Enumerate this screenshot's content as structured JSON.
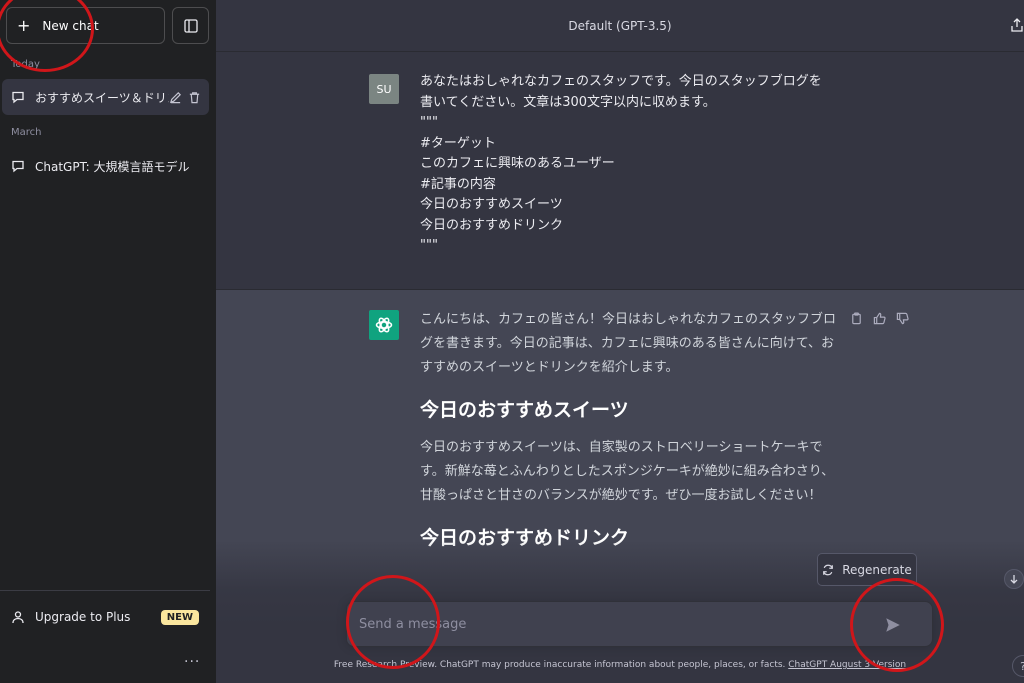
{
  "sidebar": {
    "new_chat_label": "New chat",
    "sections": [
      {
        "label": "Today"
      },
      {
        "label": "March"
      }
    ],
    "chats": [
      {
        "label": "おすすめスイーツ＆ドリンク"
      },
      {
        "label": "ChatGPT: 大規模言語モデル"
      }
    ],
    "upgrade_label": "Upgrade to Plus",
    "upgrade_badge": "NEW",
    "more_label": "..."
  },
  "header": {
    "model_title": "Default (GPT-3.5)"
  },
  "conversation": {
    "user": {
      "avatar_initials": "SU",
      "lines": [
        "あなたはおしゃれなカフェのスタッフです。今日のスタッフブログを",
        "書いてください。文章は300文字以内に収めます。",
        "\"\"\"",
        "#ターゲット",
        "このカフェに興味のあるユーザー",
        "#記事の内容",
        "今日のおすすめスイーツ",
        "今日のおすすめドリンク",
        "\"\"\""
      ]
    },
    "assistant": {
      "intro": "こんにちは、カフェの皆さん！今日はおしゃれなカフェのスタッフブログを書きます。今日の記事は、カフェに興味のある皆さんに向けて、おすすめのスイーツとドリンクを紹介します。",
      "heading_1": "今日のおすすめスイーツ",
      "paragraph_1": "今日のおすすめスイーツは、自家製のストロベリーショートケーキです。新鮮な苺とふんわりとしたスポンジケーキが絶妙に組み合わさり、甘酸っぱさと甘さのバランスが絶妙です。ぜひ一度お試しください！",
      "heading_2": "今日のおすすめドリンク"
    }
  },
  "composer": {
    "regenerate_label": "Regenerate",
    "placeholder": "Send a message",
    "value": ""
  },
  "footer": {
    "text": "Free Research Preview. ChatGPT may produce inaccurate information about people, places, or facts. ",
    "link_text": "ChatGPT August 3 Version",
    "help_label": "?"
  },
  "colors": {
    "sidebar_bg": "#202123",
    "main_bg": "#343541",
    "assistant_bg": "#444654",
    "gpt_avatar": "#10a37f",
    "user_avatar": "#7b8582",
    "annotation": "#d0161a",
    "badge_new": "#fae69e"
  }
}
